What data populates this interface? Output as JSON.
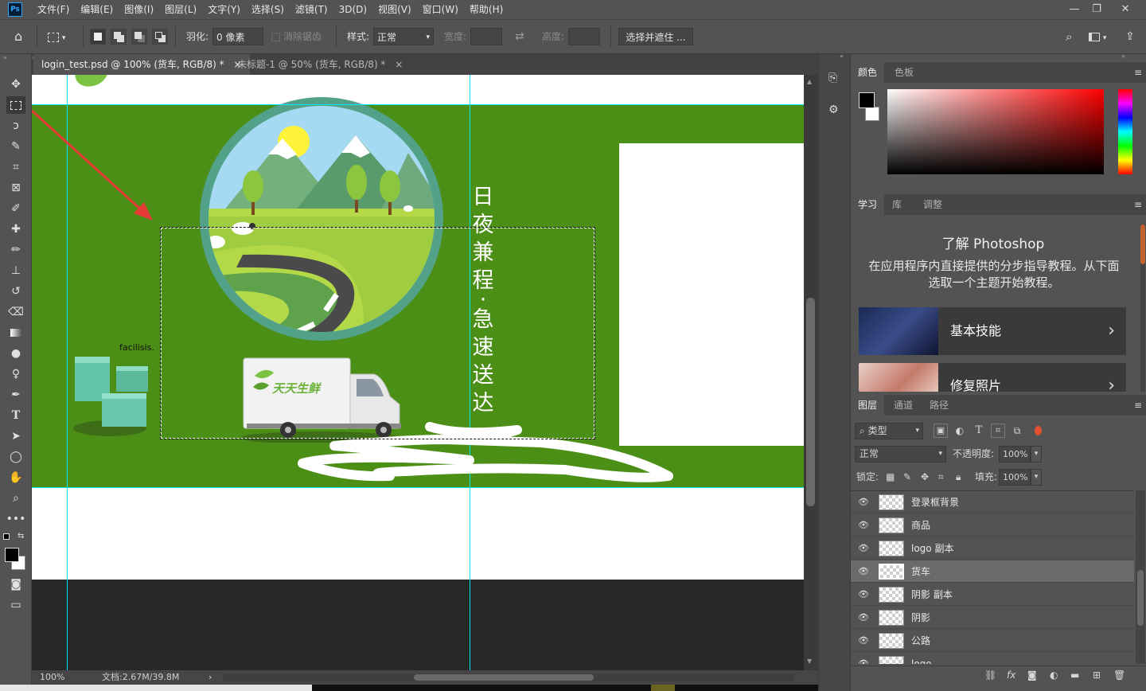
{
  "app": {
    "logo": "Ps"
  },
  "menu": [
    "文件(F)",
    "编辑(E)",
    "图像(I)",
    "图层(L)",
    "文字(Y)",
    "选择(S)",
    "滤镜(T)",
    "3D(D)",
    "视图(V)",
    "窗口(W)",
    "帮助(H)"
  ],
  "options": {
    "feather_label": "羽化:",
    "feather_value": "0 像素",
    "antialias_label": "消除锯齿",
    "style_label": "样式:",
    "style_value": "正常",
    "width_label": "宽度:",
    "height_label": "高度:",
    "select_mask_button": "选择并遮住 ..."
  },
  "tabs": [
    {
      "title": "login_test.psd @ 100% (货车, RGB/8) *",
      "close": "×"
    },
    {
      "title": "未标题-1 @ 50% (货车, RGB/8) *",
      "close": "×"
    }
  ],
  "canvas": {
    "vertical_text": [
      "日",
      "夜",
      "兼",
      "程",
      "·",
      "急",
      "速",
      "送",
      "达"
    ],
    "small_text": "facilisis.",
    "truck_brand": "天天生鲜",
    "colors": {
      "green_bg": "#4b8f17",
      "guide": "#00e5ff",
      "white": "#ffffff",
      "arrow": "#e53935"
    }
  },
  "status": {
    "zoom": "100%",
    "doc": "文档:2.67M/39.8M",
    "nav_right": "›"
  },
  "color_panel": {
    "tabs": [
      "颜色",
      "色板"
    ],
    "menu_icon": "≡"
  },
  "learn_panel": {
    "tabs": [
      "学习",
      "库",
      "调整"
    ],
    "title": "了解 Photoshop",
    "description": "在应用程序内直接提供的分步指导教程。从下面选取一个主题开始教程。",
    "cards": [
      {
        "label": "基本技能"
      },
      {
        "label": "修复照片"
      }
    ],
    "chevron": "›"
  },
  "layers_panel": {
    "tabs": [
      "图层",
      "通道",
      "路径"
    ],
    "filter_label": "类型",
    "blend_mode": "正常",
    "opacity_label": "不透明度:",
    "opacity_value": "100%",
    "lock_label": "锁定:",
    "fill_label": "填充:",
    "fill_value": "100%",
    "layers": [
      {
        "name": "登录框背景",
        "selected": false
      },
      {
        "name": "商品",
        "selected": false
      },
      {
        "name": "logo 副本",
        "selected": false
      },
      {
        "name": "货车",
        "selected": true
      },
      {
        "name": "阴影 副本",
        "selected": false
      },
      {
        "name": "阴影",
        "selected": false
      },
      {
        "name": "公路",
        "selected": false
      },
      {
        "name": "logo",
        "selected": false
      }
    ],
    "footer_icons": [
      "link-icon",
      "fx-icon",
      "mask-icon",
      "adjustment-icon",
      "group-icon",
      "new-layer-icon",
      "trash-icon"
    ]
  }
}
